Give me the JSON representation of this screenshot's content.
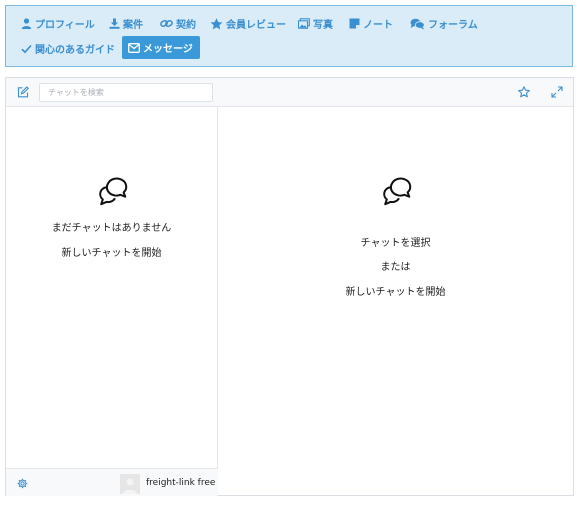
{
  "nav": {
    "items": [
      {
        "label": "プロフィール",
        "icon": "user-icon"
      },
      {
        "label": "案件",
        "icon": "download-icon"
      },
      {
        "label": "契約",
        "icon": "link-icon"
      },
      {
        "label": "会員レビュー",
        "icon": "star-icon"
      },
      {
        "label": "写真",
        "icon": "photo-icon"
      },
      {
        "label": "ノート",
        "icon": "note-icon"
      },
      {
        "label": "フォーラム",
        "icon": "comments-icon"
      },
      {
        "label": "関心のあるガイド",
        "icon": "check-icon"
      },
      {
        "label": "メッセージ",
        "icon": "envelope-icon",
        "active": true
      }
    ],
    "colors": {
      "background": "#daecf8",
      "border": "#7fb9e0",
      "link": "#3a8fd0",
      "active_background": "#3a9ad9"
    }
  },
  "chat": {
    "search_placeholder": "チャットを検索",
    "list_empty": {
      "line1": "まだチャットはありません",
      "line2": "新しいチャットを開始"
    },
    "detail_empty": {
      "line1": "チャットを選択",
      "line2": "または",
      "line3": "新しいチャットを開始"
    },
    "footer": {
      "username": "freight-link free"
    }
  }
}
